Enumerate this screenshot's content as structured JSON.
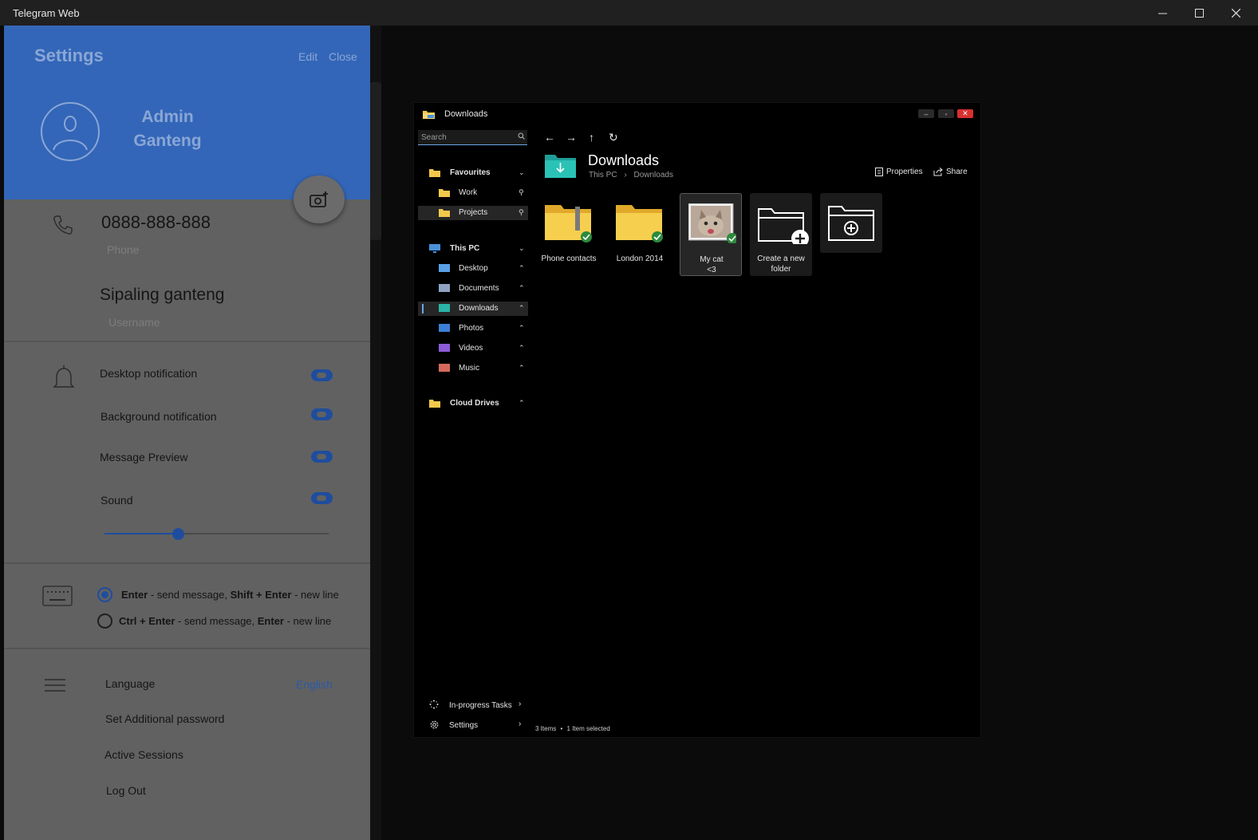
{
  "window": {
    "title": "Telegram Web",
    "controls": {
      "minimize": "—",
      "maximize": "☐",
      "close": "✕"
    }
  },
  "settings": {
    "title": "Settings",
    "edit_label": "Edit",
    "close_label": "Close",
    "profile_name": "Admin Ganteng",
    "phone": {
      "value": "0888-888-888",
      "label": "Phone"
    },
    "username": {
      "value": "Sipaling ganteng",
      "label": "Username"
    },
    "notifications": [
      {
        "label": "Desktop notification",
        "enabled": true
      },
      {
        "label": "Background notification",
        "enabled": true
      },
      {
        "label": "Message Preview",
        "enabled": true
      },
      {
        "label": "Sound",
        "enabled": true
      }
    ],
    "sound_volume_fraction": 0.33,
    "send_options": [
      {
        "selected": true,
        "key1": "Enter",
        "text1": " - send message, ",
        "key2": "Shift + Enter",
        "text2": " - new line"
      },
      {
        "selected": false,
        "key1": "Ctrl + Enter",
        "text1": " - send message, ",
        "key2": "Enter",
        "text2": " - new line"
      }
    ],
    "menu": {
      "language_label": "Language",
      "language_value": "English",
      "additional_password": "Set Additional password",
      "active_sessions": "Active Sessions",
      "log_out": "Log Out"
    },
    "colors": {
      "header": "#3366b8",
      "accent": "#1f4d9e",
      "panel": "#616161"
    }
  },
  "explorer": {
    "title": "Downloads",
    "window_controls": {
      "min": "–",
      "max": "◦",
      "close": "✕"
    },
    "search_placeholder": "Search",
    "nav": {
      "favourites": "Favourites",
      "favourites_items": [
        "Work",
        "Projects"
      ],
      "this_pc": "This PC",
      "this_pc_items": [
        "Desktop",
        "Documents",
        "Downloads",
        "Photos",
        "Videos",
        "Music"
      ],
      "cloud_drives": "Cloud Drives",
      "in_progress": "In-progress Tasks",
      "settings": "Settings"
    },
    "heading": "Downloads",
    "breadcrumb": [
      "This PC",
      "Downloads"
    ],
    "breadcrumb_sep": "›",
    "actions": {
      "properties": "Properties",
      "share": "Share"
    },
    "items": [
      {
        "name": "Phone contacts",
        "type": "zip-folder-icon"
      },
      {
        "name": "London 2014",
        "type": "folder-icon"
      },
      {
        "name_line1": "My cat",
        "name_line2": "<3",
        "type": "image-thumbnail",
        "selected": true
      },
      {
        "name_line1": "Create a new",
        "name_line2": "folder",
        "type": "new-folder-icon"
      },
      {
        "type": "add-folder-icon"
      }
    ],
    "status": {
      "items": "3 Items",
      "dot": "•",
      "selected": "1 Item selected"
    }
  }
}
